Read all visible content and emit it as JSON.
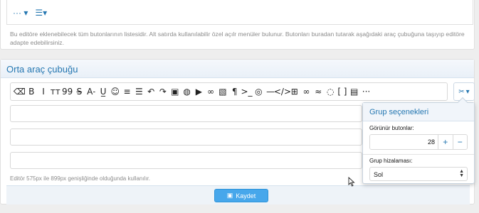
{
  "top_panel": {
    "mini_tools": {
      "more_label": "··· ▾",
      "list_label": "☰▾"
    },
    "description": "Bu editöre eklenebilecek tüm butonlarının listesidir. Alt satırda kullanılabilir özel açılr menüler bulunur. Butonları buradan tutarak aşağıdaki araç çubuğuna taşıyıp editöre adapte edebilirsiniz."
  },
  "main_panel": {
    "title": "Orta araç çubuğu",
    "toolbar_icons": [
      {
        "name": "eraser-icon",
        "glyph": "⌫"
      },
      {
        "name": "bold-icon",
        "glyph": "B"
      },
      {
        "name": "italic-icon",
        "glyph": "I"
      },
      {
        "name": "font-size-icon",
        "glyph": "ᴛᴛ"
      },
      {
        "name": "quote-icon",
        "glyph": "99"
      },
      {
        "name": "strikethrough-icon",
        "glyph": "S̶"
      },
      {
        "name": "font-color-icon",
        "glyph": "A˗"
      },
      {
        "name": "underline-icon",
        "glyph": "U̲"
      },
      {
        "name": "smiley-icon",
        "glyph": "☺"
      },
      {
        "name": "align-icon",
        "glyph": "≡"
      },
      {
        "name": "list-icon",
        "glyph": "☰"
      },
      {
        "name": "undo-icon",
        "glyph": "↶"
      },
      {
        "name": "redo-icon",
        "glyph": "↷"
      },
      {
        "name": "image-icon",
        "glyph": "▣"
      },
      {
        "name": "palette-icon",
        "glyph": "◍"
      },
      {
        "name": "media-icon",
        "glyph": "▶"
      },
      {
        "name": "link-icon",
        "glyph": "∞"
      },
      {
        "name": "gallery-icon",
        "glyph": "▧"
      },
      {
        "name": "paragraph-icon",
        "glyph": "¶"
      },
      {
        "name": "terminal-icon",
        "glyph": ">_"
      },
      {
        "name": "spoiler-icon",
        "glyph": "◎"
      },
      {
        "name": "horizontal-rule-icon",
        "glyph": "—"
      },
      {
        "name": "code-icon",
        "glyph": "</>"
      },
      {
        "name": "table-icon",
        "glyph": "⊞"
      },
      {
        "name": "mask-icon",
        "glyph": "∞"
      },
      {
        "name": "bezier-icon",
        "glyph": "≈"
      },
      {
        "name": "comment-icon",
        "glyph": "◌"
      },
      {
        "name": "brackets-icon",
        "glyph": "[ ]"
      },
      {
        "name": "save-draft-icon",
        "glyph": "▤"
      },
      {
        "name": "more-icon",
        "glyph": "···"
      }
    ],
    "description": "Editör 575px ile 899px genişliğinde olduğunda kullanılır.",
    "save_label": "Kaydet"
  },
  "group_menu": {
    "title": "Grup seçenekleri",
    "visible_buttons_label": "Görünür butonlar:",
    "visible_buttons_value": "28",
    "plus_label": "+",
    "minus_label": "−",
    "alignment_label": "Grup hizalaması:",
    "alignment_value": "Sol"
  },
  "colors": {
    "accent": "#2577b1",
    "button": "#47a7eb"
  }
}
